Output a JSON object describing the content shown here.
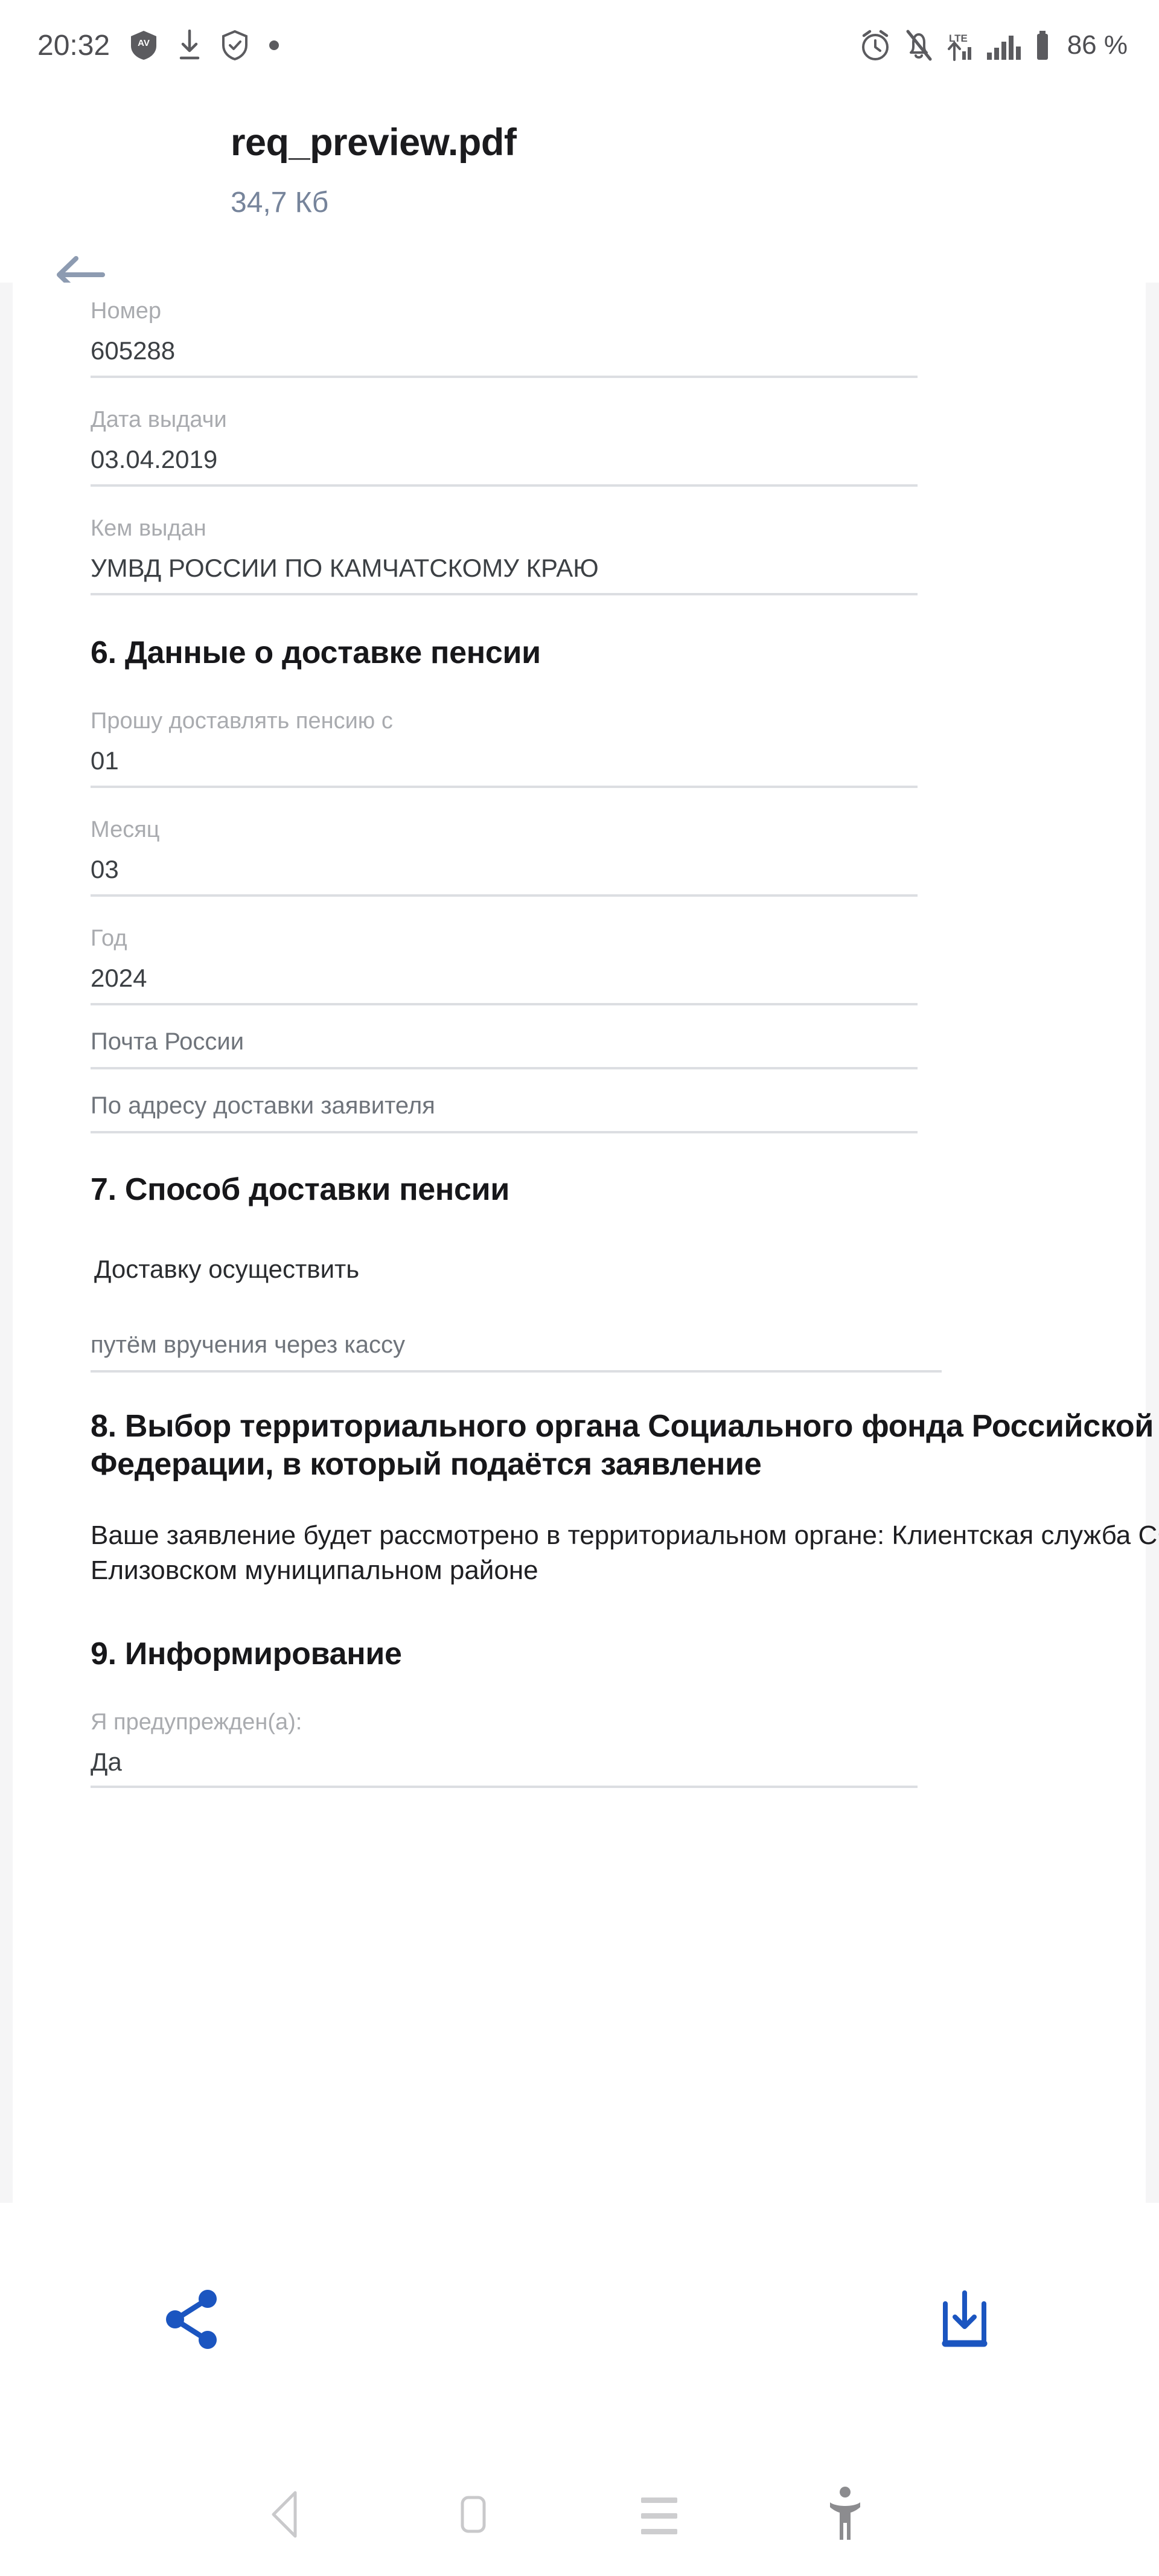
{
  "status_bar": {
    "time": "20:32",
    "battery_percent": "86 %",
    "left_icons": [
      "antivirus-shield-icon",
      "download-arrow-icon",
      "shield-check-icon",
      "dot-icon"
    ],
    "right_icons": [
      "alarm-clock-icon",
      "bell-muted-icon",
      "lte-signal-icon",
      "signal-bars-icon",
      "battery-icon"
    ]
  },
  "header": {
    "back_label": "back-arrow",
    "file_name": "req_preview.pdf",
    "file_size": "34,7 Кб",
    "title_color": "#1b1b1e",
    "size_color": "#76849b"
  },
  "document": {
    "fields": [
      {
        "label": "Номер",
        "value": "605288"
      },
      {
        "label": "Дата выдачи",
        "value": "03.04.2019"
      },
      {
        "label": "Кем выдан",
        "value": "УМВД РОССИИ ПО КАМЧАТСКОМУ КРАЮ"
      }
    ],
    "section6": {
      "title": "6. Данные о доставке пенсии",
      "fields": [
        {
          "label": "Прошу доставлять пенсию с",
          "value": "01"
        },
        {
          "label": "Месяц",
          "value": "03"
        },
        {
          "label": "Год",
          "value": "2024"
        }
      ],
      "standalone": [
        "Почта России",
        "По адресу доставки заявителя"
      ]
    },
    "section7": {
      "title": "7. Способ доставки пенсии",
      "lead": "Доставку осуществить",
      "value": "путём вручения через кассу"
    },
    "section8": {
      "title": "8. Выбор территориального органа Социального фонда Российской Федерации, в который подаётся заявление",
      "paragraph": "  Ваше заявление будет рассмотрено в территориальном органе: Клиентская служба СФР в Елизовском муниципальном районе"
    },
    "section9": {
      "title": "9. Информирование",
      "field": {
        "label": "Я предупрежден(а):",
        "value": "Да"
      }
    }
  },
  "action_bar": {
    "share_label": "share-icon",
    "save_label": "save-to-device-icon",
    "accent_color": "#1b55c0"
  },
  "nav_bar": {
    "back_label": "back-triangle-icon",
    "home_label": "home-square-icon",
    "recents_label": "recents-lines-icon",
    "accessibility_label": "accessibility-icon"
  }
}
